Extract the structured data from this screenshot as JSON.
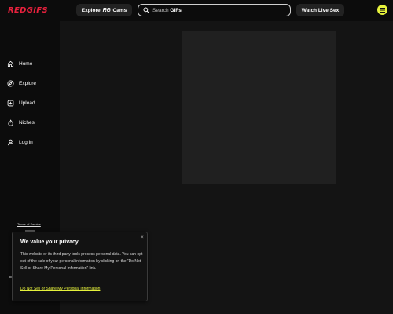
{
  "header": {
    "logo": "REDGIFS",
    "explore_label": "Explore",
    "rg_mark": "RG",
    "cams_label": "Cams",
    "search_prefix": "Search",
    "search_keyword": "GIFs",
    "live_label": "Watch Live Sex"
  },
  "sidebar": {
    "items": [
      {
        "label": "Home",
        "icon": "home-icon"
      },
      {
        "label": "Explore",
        "icon": "compass-icon"
      },
      {
        "label": "Upload",
        "icon": "upload-icon"
      },
      {
        "label": "Niches",
        "icon": "flame-icon"
      },
      {
        "label": "Log in",
        "icon": "user-icon"
      }
    ],
    "terms_label": "Terms of Service"
  },
  "privacy": {
    "title": "We value your privacy",
    "body": "This website or its third-party tools process personal data. You can opt out of the sale of your personal information by clicking on the “Do Not Sell or Share My Personal Information” link.",
    "link_label": "Do Not Sell or Share My Personal Information",
    "close_glyph": "×"
  },
  "colors": {
    "brand": "#e8213d",
    "accent": "#e6f23c",
    "background": "#0c0c0c",
    "panel": "#141414"
  }
}
